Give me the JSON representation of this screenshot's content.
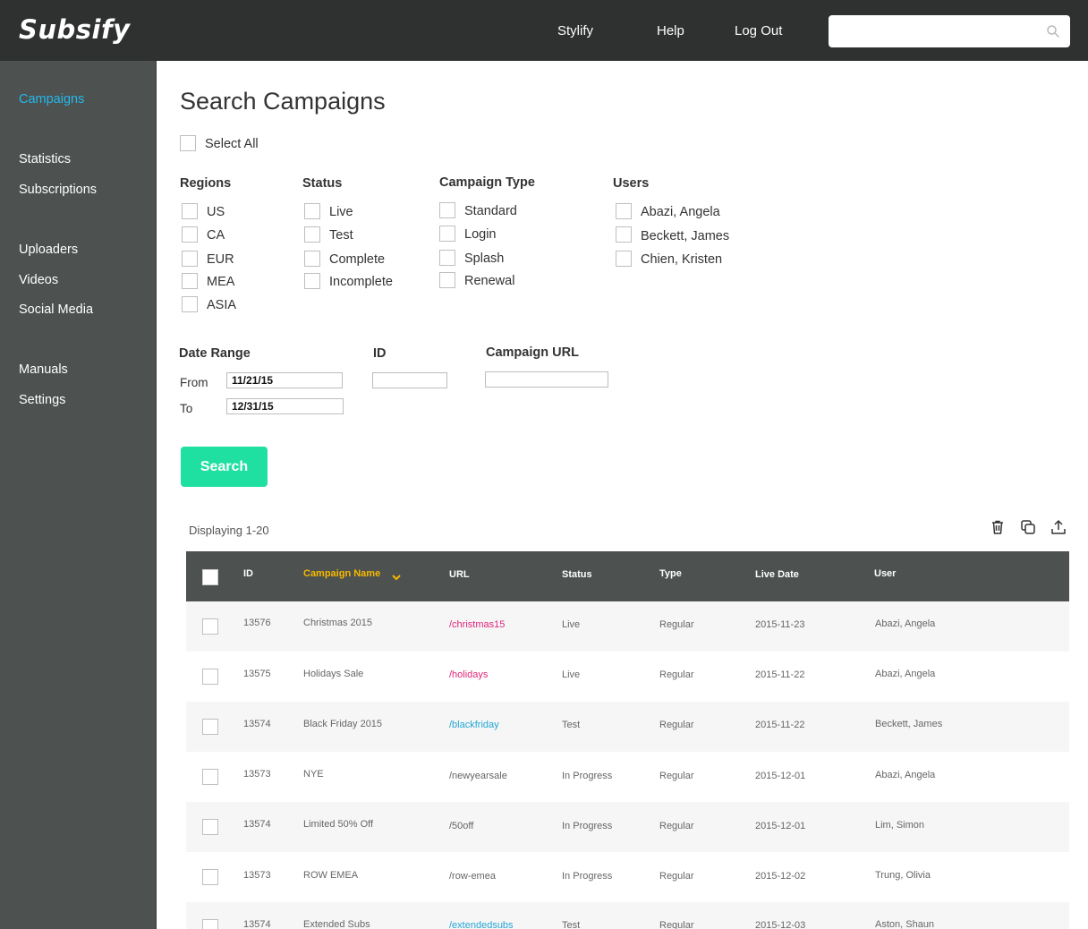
{
  "app": {
    "logo": "Subsify"
  },
  "topnav": {
    "items": [
      "Stylify",
      "Help",
      "Log Out"
    ],
    "search_placeholder": ""
  },
  "sidebar": {
    "items": [
      "Campaigns",
      "Statistics",
      "Subscriptions",
      "Uploaders",
      "Videos",
      "Social Media",
      "Manuals",
      "Settings"
    ],
    "active": "Campaigns"
  },
  "page": {
    "title": "Search Campaigns",
    "select_all": "Select All"
  },
  "filters": {
    "regions": {
      "label": "Regions",
      "options": [
        "US",
        "CA",
        "EUR",
        "MEA",
        "ASIA"
      ]
    },
    "status": {
      "label": "Status",
      "options": [
        "Live",
        "Test",
        "Complete",
        "Incomplete"
      ]
    },
    "campaign_type": {
      "label": "Campaign Type",
      "options": [
        "Standard",
        "Login",
        "Splash",
        "Renewal"
      ]
    },
    "users": {
      "label": "Users",
      "options": [
        "Abazi, Angela",
        "Beckett, James",
        "Chien, Kristen"
      ]
    }
  },
  "date_range": {
    "label": "Date Range",
    "from_label": "From",
    "to_label": "To",
    "from_value": "11/21/15",
    "to_value": "12/31/15"
  },
  "id_field": {
    "label": "ID",
    "value": ""
  },
  "url_field": {
    "label": "Campaign URL",
    "value": ""
  },
  "search_button": "Search",
  "results": {
    "displaying": "Displaying 1-20",
    "columns": [
      "ID",
      "Campaign Name",
      "URL",
      "Status",
      "Type",
      "Live Date",
      "User"
    ],
    "sorted_column": "Campaign Name",
    "rows": [
      {
        "id": "13576",
        "name": "Christmas 2015",
        "url": "/christmas15",
        "status": "Live",
        "type": "Regular",
        "date": "2015-11-23",
        "user": "Abazi, Angela"
      },
      {
        "id": "13575",
        "name": "Holidays Sale",
        "url": "/holidays",
        "status": "Live",
        "type": "Regular",
        "date": "2015-11-22",
        "user": "Abazi, Angela"
      },
      {
        "id": "13574",
        "name": "Black Friday 2015",
        "url": "/blackfriday",
        "status": "Test",
        "type": "Regular",
        "date": "2015-11-22",
        "user": "Beckett, James"
      },
      {
        "id": "13573",
        "name": "NYE",
        "url": "/newyearsale",
        "status": "In Progress",
        "type": "Regular",
        "date": "2015-12-01",
        "user": "Abazi, Angela"
      },
      {
        "id": "13574",
        "name": "Limited 50% Off",
        "url": "/50off",
        "status": "In Progress",
        "type": "Regular",
        "date": "2015-12-01",
        "user": "Lim, Simon"
      },
      {
        "id": "13573",
        "name": "ROW EMEA",
        "url": "/row-emea",
        "status": "In Progress",
        "type": "Regular",
        "date": "2015-12-02",
        "user": "Trung, Olivia"
      },
      {
        "id": "13574",
        "name": "Extended Subs",
        "url": "/extendedsubs",
        "status": "Test",
        "type": "Regular",
        "date": "2015-12-03",
        "user": "Aston, Shaun"
      }
    ]
  },
  "colors": {
    "topbar": "#2f3030",
    "sidebar": "#4d5150",
    "active": "#23b9ec",
    "button": "#1fe0a0",
    "sorted": "#f5b800",
    "link_pink": "#e0257a",
    "link_blue": "#23a6d5"
  }
}
